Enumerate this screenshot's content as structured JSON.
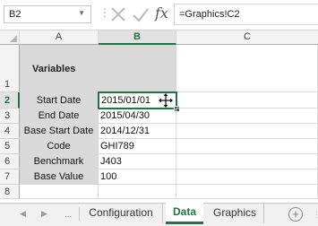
{
  "formula_bar": {
    "name_box": "B2",
    "formula": "=Graphics!C2",
    "fx_label": "fx"
  },
  "columns": [
    "A",
    "B",
    "C"
  ],
  "rows": [
    "1",
    "2",
    "3",
    "4",
    "5",
    "6",
    "7",
    "8"
  ],
  "cells": {
    "title": "Variables",
    "labels": [
      "Start Date",
      "End Date",
      "Base Start Date",
      "Code",
      "Benchmark",
      "Base Value"
    ],
    "values": [
      "2015/01/01",
      "2015/04/30",
      "2014/12/31",
      "GHI789",
      "J403",
      "100"
    ]
  },
  "selection": {
    "cell": "B2",
    "column": "B",
    "row": "2"
  },
  "sheet_tabs": {
    "dots": "...",
    "tabs": [
      "Configuration",
      "Data",
      "Graphics"
    ],
    "active": "Data",
    "add_label": "+"
  },
  "colors": {
    "accent": "#217346",
    "label_fill": "#d9d9d9"
  }
}
